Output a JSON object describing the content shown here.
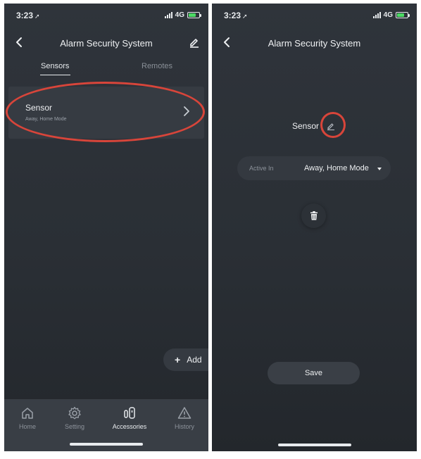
{
  "left": {
    "status": {
      "time": "3:23",
      "network": "4G"
    },
    "header": {
      "title": "Alarm Security System"
    },
    "tabs": [
      {
        "label": "Sensors",
        "active": true
      },
      {
        "label": "Remotes",
        "active": false
      }
    ],
    "sensor": {
      "name": "Sensor",
      "modes": "Away, Home Mode"
    },
    "add_label": "Add",
    "nav": [
      {
        "label": "Home",
        "icon": "house-icon"
      },
      {
        "label": "Setting",
        "icon": "gear-icon"
      },
      {
        "label": "Accessories",
        "icon": "accessory-sensor-icon",
        "active": true
      },
      {
        "label": "History",
        "icon": "warning-triangle-icon"
      }
    ]
  },
  "right": {
    "status": {
      "time": "3:23",
      "network": "4G"
    },
    "header": {
      "title": "Alarm Security System"
    },
    "sensor_name": "Sensor",
    "active_in": {
      "label": "Active In",
      "value": "Away, Home Mode"
    },
    "save_label": "Save"
  },
  "colors": {
    "background": "#2f343b",
    "card": "#363b42",
    "highlight": "#d8453a",
    "battery": "#4cd964"
  }
}
